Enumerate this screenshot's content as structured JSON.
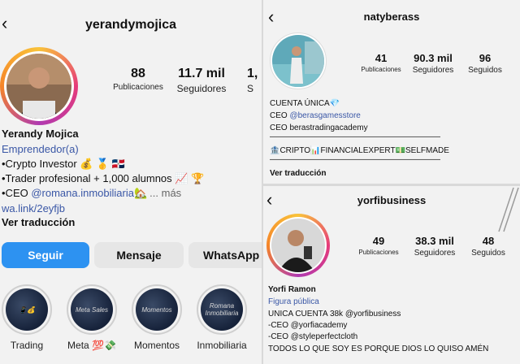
{
  "panel1": {
    "username": "yerandymojica",
    "stats": [
      {
        "num": "88",
        "label": "Publicaciones"
      },
      {
        "num": "11.7 mil",
        "label": "Seguidores"
      },
      {
        "num": "1,",
        "label": "S"
      }
    ],
    "name": "Yerandy Mojica",
    "category": "Emprendedor(a)",
    "bio": [
      "•Crypto Investor 💰 🥇 🇩🇴",
      "•Trader profesional + 1,000 alumnos 📈 🏆",
      "•CEO @romana.inmobiliaria🏡"
    ],
    "more": "... más",
    "link": "wa.link/2eyfjb",
    "translate": "Ver traducción",
    "buttons": {
      "follow": "Seguir",
      "message": "Mensaje",
      "whatsapp": "WhatsApp"
    },
    "highlights": [
      {
        "label": "Trading",
        "cover": "📱💰"
      },
      {
        "label": "Meta 💯💸",
        "cover": "Meta Sales"
      },
      {
        "label": "Momentos",
        "cover": "Momentos"
      },
      {
        "label": "Inmobiliaria",
        "cover": "Romana Inmobiliaria"
      }
    ]
  },
  "panel2": {
    "username": "natyberass",
    "stats": [
      {
        "num": "41",
        "label": "Publicaciones"
      },
      {
        "num": "90.3 mil",
        "label": "Seguidores"
      },
      {
        "num": "96",
        "label": "Seguidos"
      }
    ],
    "bio": [
      "CUENTA ÚNICA💎",
      "CEO @berasgamesstore",
      "CEO berastradingacademy",
      "—————————————————————",
      "🏦CRIPTO📊FINANCIALEXPERT💵SELFMADE",
      "—————————————————————"
    ],
    "translate": "Ver traducción"
  },
  "panel3": {
    "username": "yorfibusiness",
    "stats": [
      {
        "num": "49",
        "label": "Publicaciones"
      },
      {
        "num": "38.3 mil",
        "label": "Seguidores"
      },
      {
        "num": "48",
        "label": "Seguidos"
      }
    ],
    "name": "Yorfi Ramon",
    "category": "Figura pública",
    "bio": [
      "UNICA CUENTA 38k @yorfibusiness",
      "-CEO @yorfiacademy",
      "-CEO @styleperfectcloth",
      "TODOS LO QUE SOY ES PORQUE DIOS LO QUISO AMÉN"
    ]
  }
}
